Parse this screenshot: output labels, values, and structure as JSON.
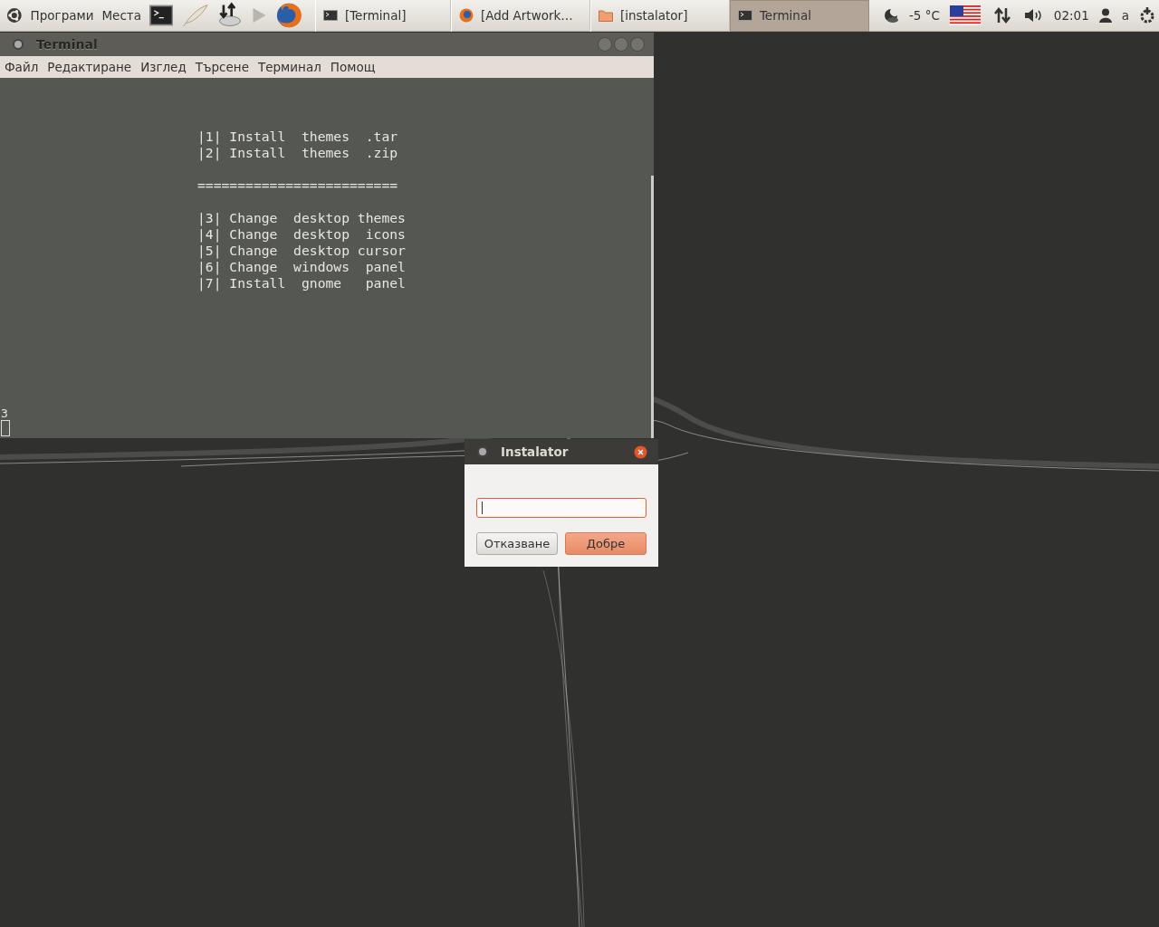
{
  "top_panel": {
    "menus": [
      {
        "label": "Програми"
      },
      {
        "label": "Места"
      }
    ],
    "tasks": [
      {
        "label": "[Terminal]",
        "kind": "terminal",
        "selected": false
      },
      {
        "label": "[Add Artwork…",
        "kind": "browser",
        "selected": false
      },
      {
        "label": "[instalator]",
        "kind": "folder",
        "selected": false
      },
      {
        "label": "Terminal",
        "kind": "terminal",
        "selected": true
      }
    ],
    "weather": "-5 °C",
    "clock": "02:01",
    "user": "a"
  },
  "terminal": {
    "title": "Terminal",
    "menu": [
      "Файл",
      "Редактиране",
      "Изглед",
      "Търсене",
      "Терминал",
      "Помощ"
    ],
    "block_1": [
      "|1| Install  themes  .tar",
      "|2| Install  themes  .zip"
    ],
    "separator": "=========================",
    "block_2": [
      "|3| Change  desktop themes",
      "|4| Change  desktop  icons",
      "|5| Change  desktop cursor",
      "|6| Change  windows  panel",
      "|7| Install  gnome   panel"
    ],
    "input": "3"
  },
  "dialog": {
    "title": "Instalator",
    "buttons": [
      {
        "label": "Отказване",
        "kind": "cancel"
      },
      {
        "label": "Добре",
        "kind": "default"
      }
    ]
  }
}
